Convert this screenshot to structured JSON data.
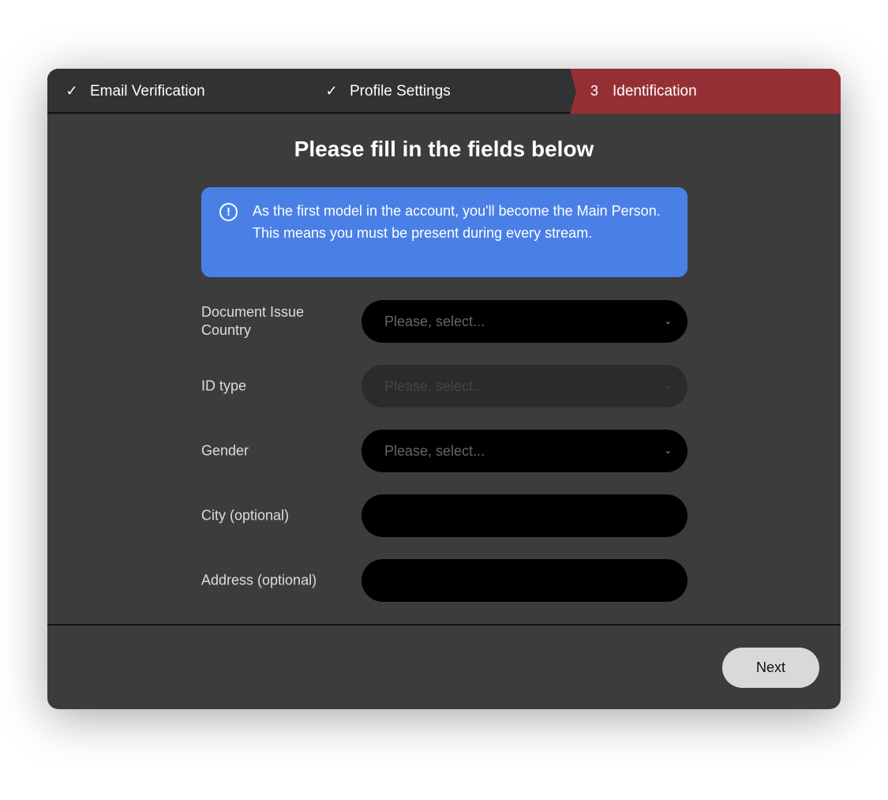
{
  "steps": [
    {
      "label": "Email Verification",
      "icon": "check-icon",
      "mark": "✓"
    },
    {
      "label": "Profile Settings",
      "icon": "check-icon",
      "mark": "✓"
    },
    {
      "label": "Identification",
      "number": "3"
    }
  ],
  "title": "Please fill in the fields below",
  "info": {
    "icon": "exclamation-circle-icon",
    "text": "As the first model in the account, you'll become the Main Person. This means you must be present during every stream."
  },
  "fields": [
    {
      "label": "Document Issue Country",
      "placeholder": "Please, select...",
      "type": "select"
    },
    {
      "label": "ID type",
      "placeholder": "Please, select...",
      "type": "select",
      "disabled": true
    },
    {
      "label": "Gender",
      "placeholder": "Please, select...",
      "type": "select"
    },
    {
      "label": "City (optional)",
      "value": "",
      "type": "text"
    },
    {
      "label": "Address (optional)",
      "value": "",
      "type": "text"
    }
  ],
  "next_label": "Next",
  "colors": {
    "active_step": "#962f33",
    "info": "#4a80e6"
  }
}
